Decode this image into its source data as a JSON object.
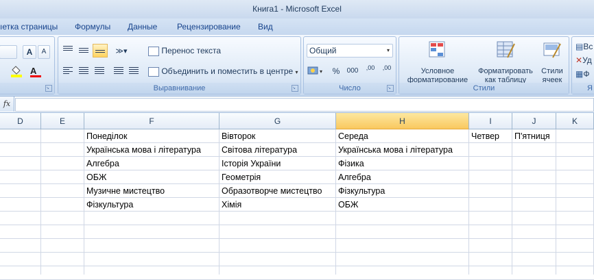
{
  "window": {
    "title": "Книга1 - Microsoft Excel"
  },
  "tabs": [
    {
      "label": "ıетка страницы"
    },
    {
      "label": "Формулы"
    },
    {
      "label": "Данные"
    },
    {
      "label": "Рецензирование"
    },
    {
      "label": "Вид"
    }
  ],
  "ribbon": {
    "font_group": {
      "grow_label": "A",
      "shrink_label": "A",
      "font_color_label": "A"
    },
    "alignment": {
      "label": "Выравнивание",
      "wrap_text": "Перенос текста",
      "merge_center": "Объединить и поместить в центре"
    },
    "number": {
      "label": "Число",
      "format_value": "Общий",
      "percent": "%",
      "thousands": "000",
      "inc_decimal": ",00",
      "dec_decimal": ",00"
    },
    "styles": {
      "label": "Стили",
      "conditional_line1": "Условное",
      "conditional_line2": "форматирование",
      "table_line1": "Форматировать",
      "table_line2": "как таблицу",
      "cell_line1": "Стили",
      "cell_line2": "ячеек"
    },
    "cells": {
      "insert": "Вс",
      "delete": "Уд",
      "format": "Ф",
      "label": "Я"
    }
  },
  "formula_bar": {
    "fx_label": "fx",
    "value": ""
  },
  "sheet": {
    "columns": [
      "D",
      "E",
      "F",
      "G",
      "H",
      "I",
      "J",
      "K"
    ],
    "rows": [
      [
        "",
        "",
        "Понеділок",
        "Вівторок",
        "Середа",
        "Четвер",
        "П'ятниця",
        ""
      ],
      [
        "",
        "",
        "Українська мова і література",
        "Світова література",
        "Українська мова і література",
        "",
        "",
        ""
      ],
      [
        "",
        "",
        "Алгебра",
        "Історія України",
        "Фізика",
        "",
        "",
        ""
      ],
      [
        "",
        "",
        "ОБЖ",
        "Геометрія",
        "Алгебра",
        "",
        "",
        ""
      ],
      [
        "",
        "",
        "Музичне мистецтво",
        "Образотворче мистецтво",
        "Фізкультура",
        "",
        "",
        ""
      ],
      [
        "",
        "",
        "Фізкультура",
        "Хімія",
        "ОБЖ",
        "",
        "",
        ""
      ]
    ],
    "empty_row_count": 5,
    "selected_column": "H"
  }
}
